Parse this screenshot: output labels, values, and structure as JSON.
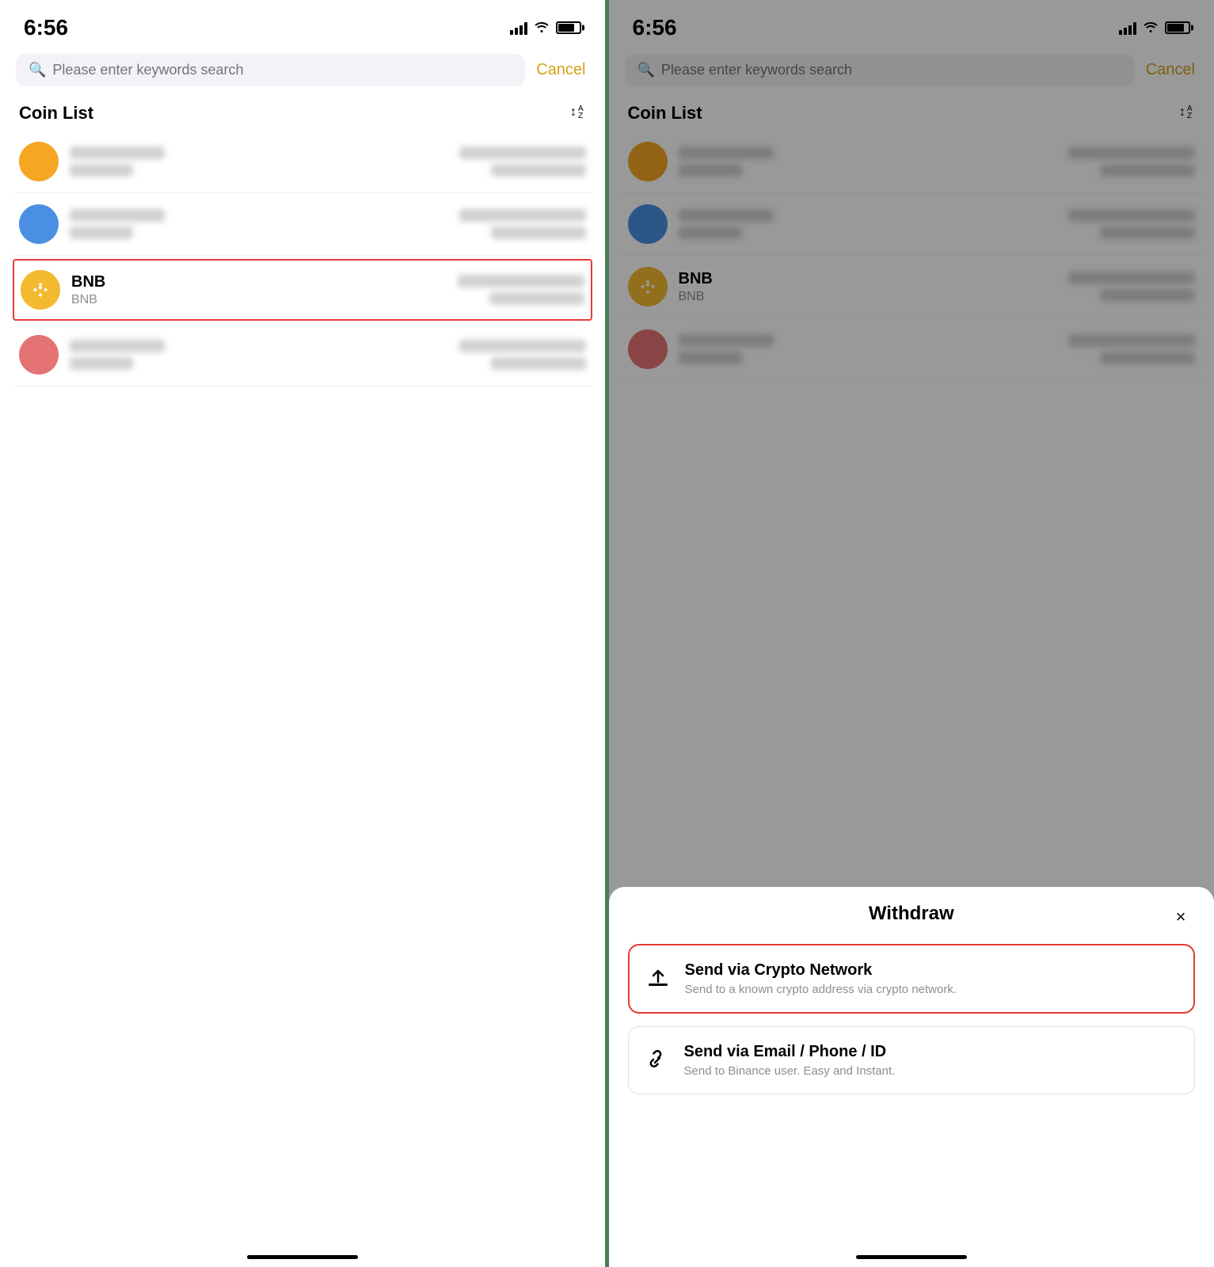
{
  "left_panel": {
    "status": {
      "time": "6:56"
    },
    "search": {
      "placeholder": "Please enter keywords search",
      "cancel_label": "Cancel"
    },
    "coin_list": {
      "title": "Coin List",
      "items": [
        {
          "id": "coin1",
          "color": "orange",
          "name": "",
          "symbol": "",
          "blurred": true
        },
        {
          "id": "coin2",
          "color": "blue",
          "name": "",
          "symbol": "",
          "blurred": true
        },
        {
          "id": "bnb",
          "color": "bnb",
          "name": "BNB",
          "symbol": "BNB",
          "blurred": false,
          "highlighted": true
        },
        {
          "id": "coin4",
          "color": "pink",
          "name": "",
          "symbol": "",
          "blurred": true
        }
      ]
    }
  },
  "right_panel": {
    "status": {
      "time": "6:56"
    },
    "search": {
      "placeholder": "Please enter keywords search",
      "cancel_label": "Cancel"
    },
    "coin_list": {
      "title": "Coin List"
    },
    "bottom_sheet": {
      "title": "Withdraw",
      "close_label": "×",
      "options": [
        {
          "id": "crypto-network",
          "title": "Send via Crypto Network",
          "description": "Send to a known crypto address via crypto network.",
          "highlighted": true
        },
        {
          "id": "email-phone",
          "title": "Send via Email / Phone / ID",
          "description": "Send to Binance user. Easy and Instant.",
          "highlighted": false
        }
      ]
    }
  }
}
